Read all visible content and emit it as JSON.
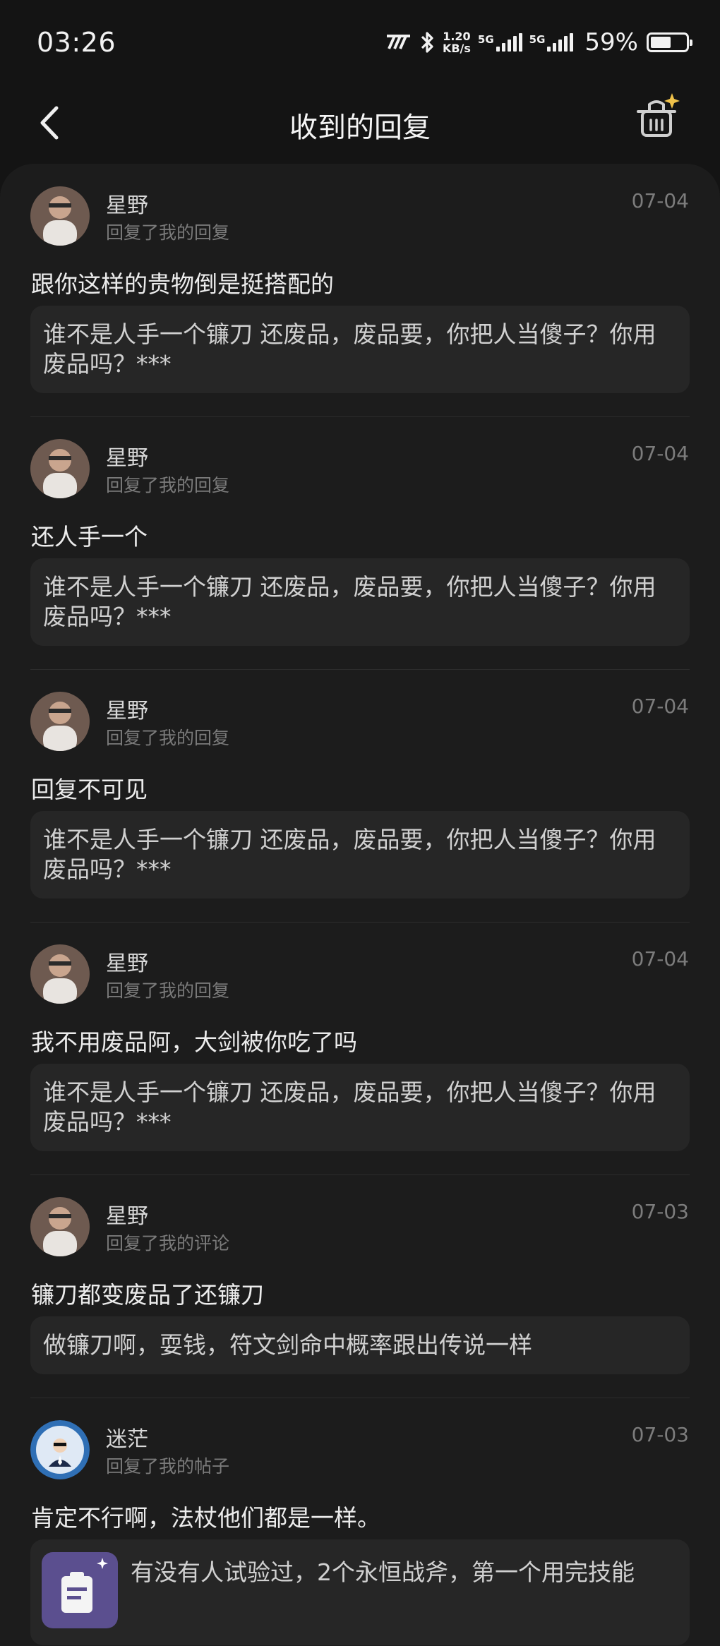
{
  "status_bar": {
    "time": "03:26",
    "net_speed_value": "1.20",
    "net_speed_unit": "KB/s",
    "sim1_label": "5G",
    "sim2_label": "5G",
    "battery_percent": "59%",
    "battery_level": 0.59
  },
  "header": {
    "title": "收到的回复",
    "back_icon": "chevron-left-icon",
    "clean_icon": "basket-sparkle-icon"
  },
  "replies": [
    {
      "username": "星野",
      "action": "回复了我的回复",
      "date": "07-04",
      "reply": "跟你这样的贵物倒是挺搭配的",
      "quote": "谁不是人手一个镰刀 还废品，废品要，你把人当傻子？你用废品吗？***"
    },
    {
      "username": "星野",
      "action": "回复了我的回复",
      "date": "07-04",
      "reply": "还人手一个",
      "quote": "谁不是人手一个镰刀 还废品，废品要，你把人当傻子？你用废品吗？***"
    },
    {
      "username": "星野",
      "action": "回复了我的回复",
      "date": "07-04",
      "reply": "回复不可见",
      "quote": "谁不是人手一个镰刀 还废品，废品要，你把人当傻子？你用废品吗？***"
    },
    {
      "username": "星野",
      "action": "回复了我的回复",
      "date": "07-04",
      "reply": "我不用废品阿，大剑被你吃了吗",
      "quote": "谁不是人手一个镰刀 还废品，废品要，你把人当傻子？你用废品吗？***"
    },
    {
      "username": "星野",
      "action": "回复了我的评论",
      "date": "07-03",
      "reply": "镰刀都变废品了还镰刀",
      "quote": "做镰刀啊，耍钱，符文剑命中概率跟出传说一样"
    },
    {
      "username": "迷茫",
      "action": "回复了我的帖子",
      "date": "07-03",
      "reply": "肯定不行啊，法杖他们都是一样。",
      "quote": "有没有人试验过，2个永恒战斧，第一个用完技能"
    }
  ],
  "colors": {
    "background": "#141414",
    "panel": "#1c1c1c",
    "quote_bg": "#262626",
    "muted_text": "#7a7a7a"
  }
}
